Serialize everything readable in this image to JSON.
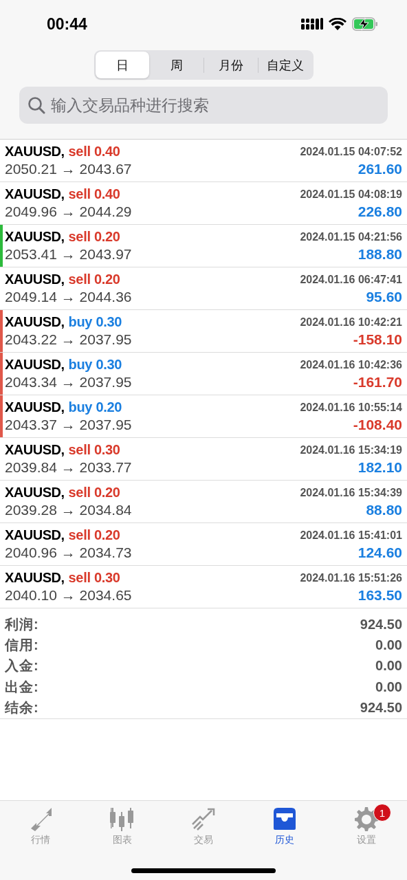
{
  "status_bar": {
    "time": "00:44"
  },
  "period_tabs": [
    {
      "label": "日",
      "selected": true
    },
    {
      "label": "周",
      "selected": false
    },
    {
      "label": "月份",
      "selected": false
    },
    {
      "label": "自定义",
      "selected": false
    }
  ],
  "search": {
    "placeholder": "输入交易品种进行搜索"
  },
  "deals": [
    {
      "symbol": "XAUUSD,",
      "side": "sell 0.40",
      "kind": "sell",
      "time": "2024.01.15 04:07:52",
      "prices": "2050.21 → 2043.67",
      "profit": "261.60",
      "loss": false
    },
    {
      "symbol": "XAUUSD,",
      "side": "sell 0.40",
      "kind": "sell",
      "time": "2024.01.15 04:08:19",
      "prices": "2049.96 → 2044.29",
      "profit": "226.80",
      "loss": false
    },
    {
      "symbol": "XAUUSD,",
      "side": "sell 0.20",
      "kind": "sell",
      "time": "2024.01.15 04:21:56",
      "prices": "2053.41 → 2043.97",
      "profit": "188.80",
      "loss": false,
      "color": "#2dba3c"
    },
    {
      "symbol": "XAUUSD,",
      "side": "sell 0.20",
      "kind": "sell",
      "time": "2024.01.16 06:47:41",
      "prices": "2049.14 → 2044.36",
      "profit": "95.60",
      "loss": false
    },
    {
      "symbol": "XAUUSD,",
      "side": "buy 0.30",
      "kind": "buy",
      "time": "2024.01.16 10:42:21",
      "prices": "2043.22 → 2037.95",
      "profit": "-158.10",
      "loss": true,
      "color": "#e0584a"
    },
    {
      "symbol": "XAUUSD,",
      "side": "buy 0.30",
      "kind": "buy",
      "time": "2024.01.16 10:42:36",
      "prices": "2043.34 → 2037.95",
      "profit": "-161.70",
      "loss": true,
      "color": "#e0584a"
    },
    {
      "symbol": "XAUUSD,",
      "side": "buy 0.20",
      "kind": "buy",
      "time": "2024.01.16 10:55:14",
      "prices": "2043.37 → 2037.95",
      "profit": "-108.40",
      "loss": true,
      "color": "#e0584a"
    },
    {
      "symbol": "XAUUSD,",
      "side": "sell 0.30",
      "kind": "sell",
      "time": "2024.01.16 15:34:19",
      "prices": "2039.84 → 2033.77",
      "profit": "182.10",
      "loss": false
    },
    {
      "symbol": "XAUUSD,",
      "side": "sell 0.20",
      "kind": "sell",
      "time": "2024.01.16 15:34:39",
      "prices": "2039.28 → 2034.84",
      "profit": "88.80",
      "loss": false
    },
    {
      "symbol": "XAUUSD,",
      "side": "sell 0.20",
      "kind": "sell",
      "time": "2024.01.16 15:41:01",
      "prices": "2040.96 → 2034.73",
      "profit": "124.60",
      "loss": false
    },
    {
      "symbol": "XAUUSD,",
      "side": "sell 0.30",
      "kind": "sell",
      "time": "2024.01.16 15:51:26",
      "prices": "2040.10 → 2034.65",
      "profit": "163.50",
      "loss": false
    }
  ],
  "summary": [
    {
      "label": "利润:",
      "value": "924.50"
    },
    {
      "label": "信用:",
      "value": "0.00"
    },
    {
      "label": "入金:",
      "value": "0.00"
    },
    {
      "label": "出金:",
      "value": "0.00"
    },
    {
      "label": "结余:",
      "value": "924.50"
    }
  ],
  "tab_bar": [
    {
      "label": "行情",
      "kind": "quotes",
      "selected": false
    },
    {
      "label": "图表",
      "kind": "chart",
      "selected": false
    },
    {
      "label": "交易",
      "kind": "trade",
      "selected": false
    },
    {
      "label": "历史",
      "kind": "history",
      "selected": true
    },
    {
      "label": "设置",
      "kind": "settings",
      "selected": false,
      "badge": "1"
    }
  ]
}
